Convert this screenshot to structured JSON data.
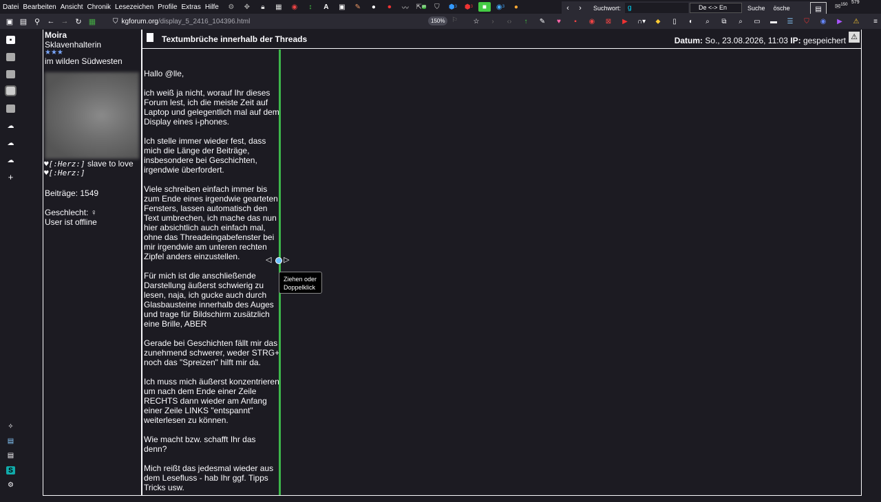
{
  "menubar": {
    "items": [
      "Datei",
      "Bearbeiten",
      "Ansicht",
      "Chronik",
      "Lesezeichen",
      "Profile",
      "Extras",
      "Hilfe"
    ]
  },
  "toolbar_badges": {
    "green_badge": "on",
    "blue_badge": "3",
    "red_badge": "3",
    "purple_badge": "3",
    "mail_badge": "150",
    "count_badge": "579"
  },
  "search": {
    "label": "Suchwort:",
    "value": "g",
    "lang": "De <-> En",
    "search_button": "Suche",
    "clear_button": "ösche"
  },
  "navbar": {
    "url_host": "kgforum.org",
    "url_path": "/display_5_2416_104396.html",
    "zoom": "150%"
  },
  "poster": {
    "name": "Moira",
    "rank": "Sklavenhalterin",
    "stars": "★★★",
    "location": "im wilden Südwesten",
    "herz_line1": "♥[:Herz:]",
    "herz_line1_rest": " slave to love",
    "herz_line2": "♥[:Herz:]",
    "posts": "Beiträge: 1549",
    "gender": "Geschlecht: ♀",
    "status": "User ist offline"
  },
  "post": {
    "title": "Textumbrüche innerhalb der Threads",
    "date_label": "Datum:",
    "date_value": " So., 23.08.2026, 11:03 ",
    "ip_label": "IP:",
    "ip_value": " gespeichert",
    "paragraphs": [
      "Hallo @lle,",
      "ich weiß ja nicht, worauf Ihr dieses Forum lest, ich die meiste Zeit auf Laptop und gelegentlich mal auf dem Display eines i-phones.",
      "Ich stelle immer wieder fest, dass mich die Länge der Beiträge, insbesondere bei Geschichten, irgendwie überfordert.",
      "Viele schreiben einfach immer bis zum Ende eines irgendwie gearteten Fensters, lassen automatisch den Text umbrechen, ich mache das nun hier absichtlich auch einfach mal, ohne das Threadeingabefenster bei mir irgendwie am unteren rechten Zipfel anders einzustellen.",
      "Für mich ist die anschließende Darstellung äußerst schwierig zu lesen, naja, ich gucke auch durch Glasbausteine innerhalb des Auges und trage für Bildschirm zusätzlich eine Brille, ABER",
      "Gerade bei Geschichten fällt mir das zunehmend schwerer, weder STRG+ noch das \"Spreizen\" hilft mir da.",
      "Ich muss mich äußerst konzentrieren um nach dem Ende einer Zeile RECHTS dann wieder am Anfang einer Zeile LINKS \"entspannt\" weiterlesen zu können.",
      "Wie macht bzw. schafft Ihr das denn?",
      "Mich reißt das jedesmal wieder aus dem Lesefluss - hab Ihr ggf. Tipps Tricks usw."
    ]
  },
  "tooltip": {
    "line1": "Ziehen oder",
    "line2": "Doppelklick"
  },
  "colors": {
    "divider": "#3db64a",
    "background": "#1c1b22",
    "toolbar": "#2b2a33"
  }
}
